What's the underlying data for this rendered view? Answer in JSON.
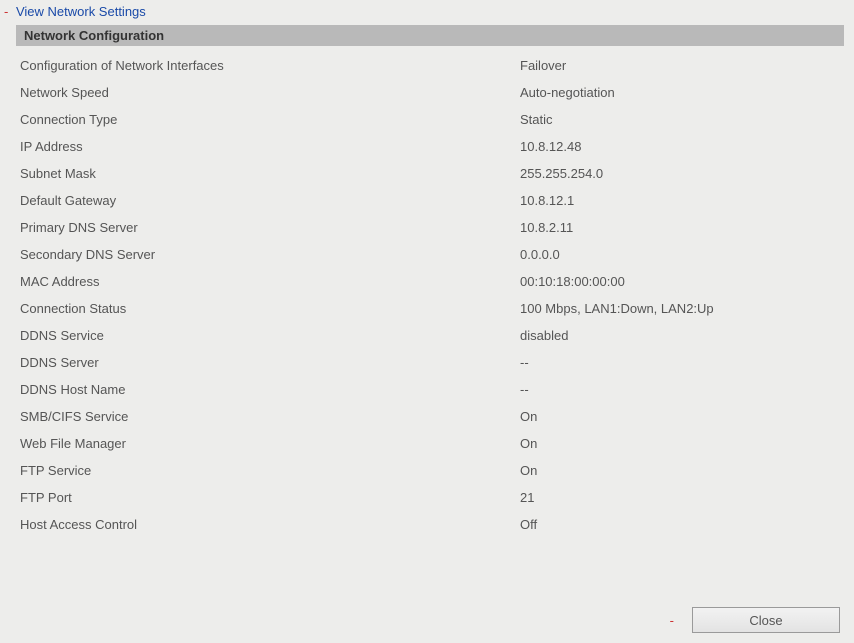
{
  "header": {
    "dash": "-",
    "title": "View Network Settings"
  },
  "section": {
    "title": "Network Configuration"
  },
  "rows": [
    {
      "label": "Configuration of Network Interfaces",
      "value": "Failover"
    },
    {
      "label": "Network Speed",
      "value": "Auto-negotiation"
    },
    {
      "label": "Connection Type",
      "value": "Static"
    },
    {
      "label": "IP Address",
      "value": "10.8.12.48"
    },
    {
      "label": "Subnet Mask",
      "value": "255.255.254.0"
    },
    {
      "label": "Default Gateway",
      "value": "10.8.12.1"
    },
    {
      "label": "Primary DNS Server",
      "value": "10.8.2.11"
    },
    {
      "label": "Secondary DNS Server",
      "value": "0.0.0.0"
    },
    {
      "label": "MAC Address",
      "value": "00:10:18:00:00:00"
    },
    {
      "label": "Connection Status",
      "value": "100 Mbps, LAN1:Down, LAN2:Up"
    },
    {
      "label": "DDNS Service",
      "value": "disabled"
    },
    {
      "label": "DDNS Server",
      "value": "--"
    },
    {
      "label": "DDNS Host Name",
      "value": "--"
    },
    {
      "label": "SMB/CIFS Service",
      "value": "On"
    },
    {
      "label": "Web File Manager",
      "value": "On"
    },
    {
      "label": "FTP Service",
      "value": "On"
    },
    {
      "label": "FTP Port",
      "value": "21"
    },
    {
      "label": "Host Access Control",
      "value": "Off"
    }
  ],
  "footer": {
    "dash": "-",
    "close_label": "Close"
  }
}
